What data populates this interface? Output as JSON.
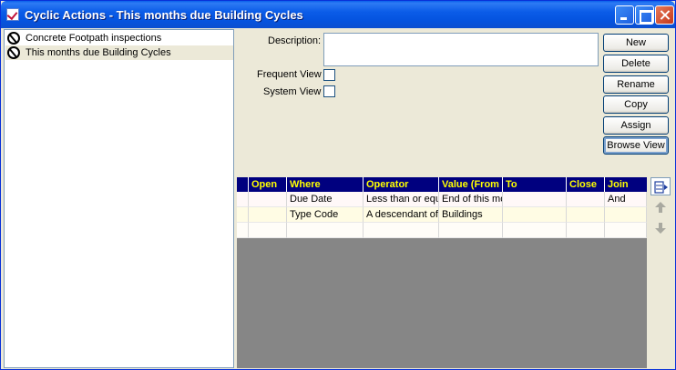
{
  "window": {
    "title": "Cyclic Actions - This months due Building Cycles"
  },
  "list": {
    "items": [
      {
        "label": "Concrete Footpath inspections"
      },
      {
        "label": "This months due Building Cycles"
      }
    ]
  },
  "form": {
    "description_label": "Description:",
    "description_value": "",
    "frequent_view_label": "Frequent View",
    "system_view_label": "System View"
  },
  "buttons": {
    "new": "New",
    "delete": "Delete",
    "rename": "Rename",
    "copy": "Copy",
    "assign": "Assign",
    "browse_view": "Browse View"
  },
  "grid": {
    "columns": [
      "Open",
      "Where",
      "Operator",
      "Value (From",
      "To",
      "Close",
      "Join"
    ],
    "rows": [
      {
        "open": "",
        "where": "Due Date",
        "operator": "Less than or equ",
        "value": "End of this mo",
        "to": "",
        "close": "",
        "join": "And"
      },
      {
        "open": "",
        "where": "Type Code",
        "operator": "A descendant of",
        "value": "Buildings",
        "to": "",
        "close": "",
        "join": ""
      },
      {
        "open": "",
        "where": "",
        "operator": "",
        "value": "",
        "to": "",
        "close": "",
        "join": ""
      }
    ]
  },
  "icons": {
    "title": "checkmark-app-icon",
    "list_item": "pickaxe-icon",
    "insert_row": "insert-row-icon",
    "move_up": "arrow-up-icon",
    "move_down": "arrow-down-icon"
  },
  "colors": {
    "title_bar": "#0A5FEB",
    "grid_header_bg": "#00007F",
    "grid_header_text": "#FFFF00",
    "face": "#ECE9D8"
  }
}
